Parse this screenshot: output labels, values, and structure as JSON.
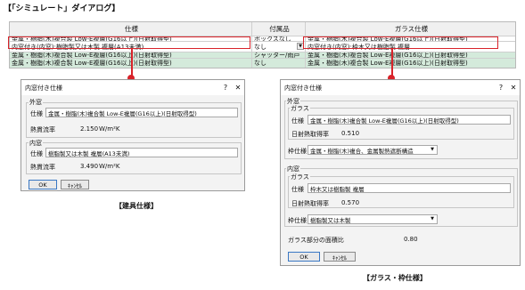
{
  "heading": "【「シミュレート」ダイアログ】",
  "table": {
    "headers": [
      "仕様",
      "付属品",
      "ガラス仕様"
    ],
    "rows": [
      [
        "金属・樹脂(木)複合製 Low-E複層(G16以上)(日射取得型)",
        "ボックスなし",
        "金属・樹脂(木)複合製 Low-E複層(G16以上)(日射取得型)"
      ],
      [
        "内窓付き(内窓):樹脂製又は木製 複層(A13未満)",
        "なし",
        "内窓付き(内窓):枠木又は樹脂製 複層"
      ],
      [
        "金属・樹脂(木)複合製 Low-E複層(G16以上)(日射取得型)",
        "シャッター/雨戸",
        "金属・樹脂(木)複合製 Low-E複層(G16以上)(日射取得型)"
      ],
      [
        "金属・樹脂(木)複合製 Low-E複層(G16以上)(日射取得型)",
        "なし",
        "金属・樹脂(木)複合製 Low-E複層(G16以上)(日射取得型)"
      ]
    ]
  },
  "dialog1": {
    "title": "内窓付き仕様",
    "help": "?",
    "close": "✕",
    "outer_group": "外窓",
    "outer_spec_label": "仕様",
    "outer_spec_value": "金属・樹脂(木)複合製 Low-E複層(G16以上)(日射取得型)",
    "outer_u_label": "熱貫流率",
    "outer_u_value": "2.150",
    "outer_u_unit": "W/m²K",
    "inner_group": "内窓",
    "inner_spec_label": "仕様",
    "inner_spec_value": "樹脂製又は木製 複層(A13未満)",
    "inner_u_label": "熱貫流率",
    "inner_u_value": "3.490",
    "inner_u_unit": "W/m²K",
    "ok": "OK",
    "cancel": "ｷｬﾝｾﾙ",
    "caption": "【建具仕様】"
  },
  "dialog2": {
    "title": "内窓付き仕様",
    "help": "?",
    "close": "✕",
    "outer_group": "外窓",
    "outer_glass_group": "ガラス",
    "outer_spec_label": "仕様",
    "outer_spec_value": "金属・樹脂(木)複合製 Low-E複層(G16以上)(日射取得型)",
    "outer_solar_label": "日射熱取得率",
    "outer_solar_value": "0.510",
    "outer_frame_label": "枠仕様",
    "outer_frame_value": "金属・樹脂(木)複合、金属製熱遮断構造",
    "inner_group": "内窓",
    "inner_glass_group": "ガラス",
    "inner_spec_label": "仕様",
    "inner_spec_value": "枠木又は樹脂製 複層",
    "inner_solar_label": "日射熱取得率",
    "inner_solar_value": "0.570",
    "inner_frame_label": "枠仕様",
    "inner_frame_value": "樹脂製又は木製",
    "area_ratio_label": "ガラス部分の面積比",
    "area_ratio_value": "0.80",
    "ok": "OK",
    "cancel": "ｷｬﾝｾﾙ",
    "caption": "【ガラス・枠仕様】"
  },
  "colors": {
    "accent_red": "#d8232a",
    "row_green": "#d4eadb"
  },
  "icons": {
    "dropdown": "chevron-down-icon"
  }
}
